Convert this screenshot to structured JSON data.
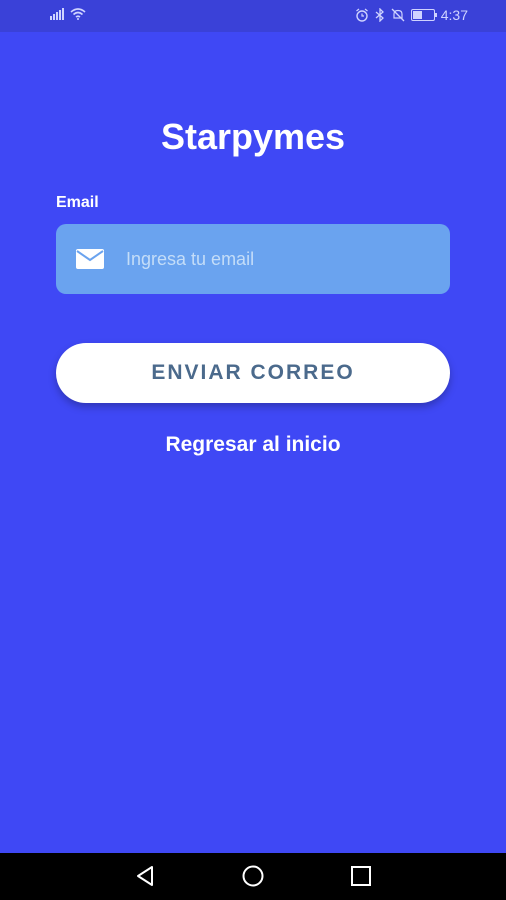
{
  "status": {
    "time": "4:37"
  },
  "app": {
    "title": "Starpymes"
  },
  "form": {
    "email_label": "Email",
    "email_placeholder": "Ingresa tu email",
    "email_value": ""
  },
  "actions": {
    "send_label": "ENVIAR CORREO",
    "back_label": "Regresar al inicio"
  },
  "colors": {
    "background": "#3f48f5",
    "input_bg": "#6aa3ef",
    "button_text": "#4b6a8c"
  },
  "icons": [
    "signal-icon",
    "wifi-icon",
    "alarm-icon",
    "bluetooth-icon",
    "mute-icon",
    "battery-icon",
    "mail-icon",
    "back-nav-icon",
    "home-nav-icon",
    "recents-nav-icon"
  ]
}
